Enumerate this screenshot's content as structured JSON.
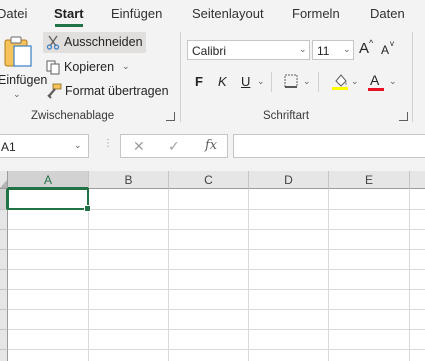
{
  "tabs": [
    "Datei",
    "Start",
    "Einfügen",
    "Seitenlayout",
    "Formeln",
    "Daten"
  ],
  "active_tab": "Start",
  "clipboard": {
    "paste_label": "Einfügen",
    "cut_label": "Ausschneiden",
    "copy_label": "Kopieren",
    "format_painter_label": "Format übertragen",
    "group_label": "Zwischenablage"
  },
  "font": {
    "font_name": "Calibri",
    "font_size": "11",
    "grow_label": "A",
    "shrink_label": "A",
    "bold_label": "F",
    "italic_label": "K",
    "underline_label": "U",
    "font_color_label": "A",
    "group_label": "Schriftart",
    "highlight_color": "#ffff00",
    "font_color": "#e81123"
  },
  "formula_bar": {
    "name_box": "A1",
    "fx_label": "fx",
    "formula_value": ""
  },
  "sheet": {
    "columns": [
      "A",
      "B",
      "C",
      "D",
      "E"
    ],
    "selected_cell": "A1",
    "accent_color": "#217346"
  }
}
